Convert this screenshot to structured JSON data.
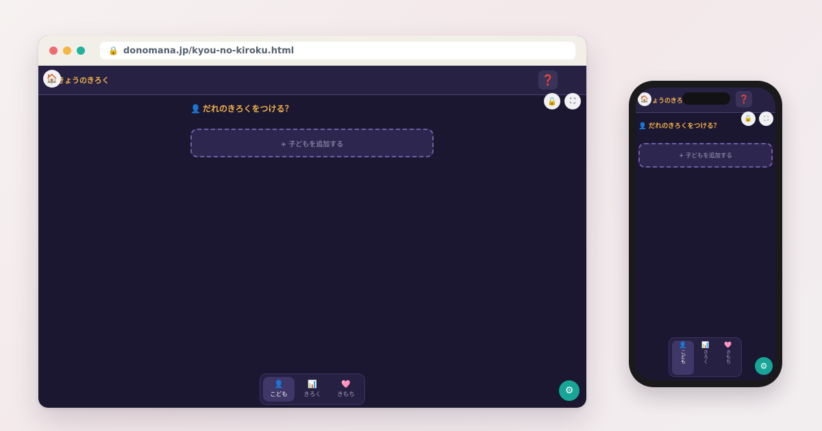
{
  "browser": {
    "url": "donomana.jp/kyou-no-kiroku.html",
    "lock_icon": "lock-icon"
  },
  "app": {
    "title": "きょうのきろく",
    "home_icon": "🏠",
    "help_icon": "❓",
    "lock_button_icon": "🔓",
    "fullscreen_icon": "⛶",
    "section_icon": "👤",
    "section_title": "だれのきろくをつける？",
    "add_child_label": "+ 子どもを追加する",
    "settings_icon": "⚙",
    "nav": [
      {
        "icon": "👤",
        "label": "こども",
        "active": true
      },
      {
        "icon": "📊",
        "label": "きろく",
        "active": false
      },
      {
        "icon": "🩷",
        "label": "きもち",
        "active": false
      }
    ]
  },
  "colors": {
    "background": "#1b1730",
    "header": "#272244",
    "accent_orange": "#f2b24c",
    "accent_teal": "#16a596",
    "dashed_border": "#6f5fa3"
  }
}
